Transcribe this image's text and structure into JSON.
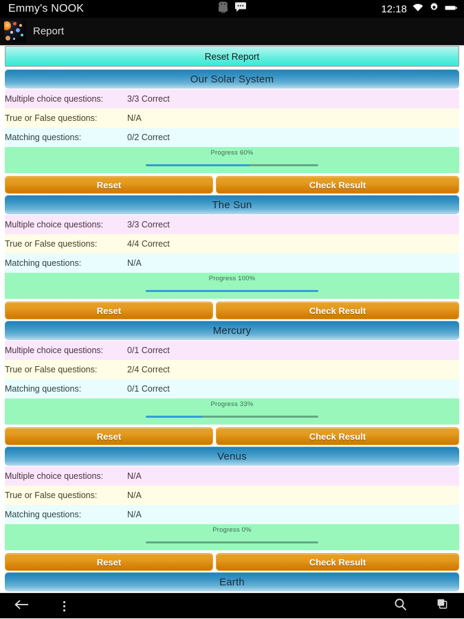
{
  "status_bar": {
    "title": "Emmy's NOOK",
    "clock": "12:18",
    "icons": [
      "android-robot-icon",
      "chat-bubble-icon",
      "wifi-icon",
      "gear-icon",
      "battery-icon"
    ]
  },
  "action_bar": {
    "app_icon": "solar-system-app-icon",
    "title": "Report"
  },
  "toolbar": {
    "reset_report_label": "Reset Report"
  },
  "labels": {
    "multiple_choice": "Multiple choice questions:",
    "true_false": "True or False questions:",
    "matching": "Matching questions:",
    "reset": "Reset",
    "check_result": "Check Result"
  },
  "colors": {
    "header_blue": "#3b96c6",
    "button_orange": "#d88409",
    "reset_report_cyan": "#39e9d4",
    "progress_bg": "#99f7bc",
    "progress_fill": "#3aa8dd",
    "progress_track": "#64a884",
    "row_mc": "#fbe7fb",
    "row_tf": "#fffde6",
    "row_mt": "#e9fdff"
  },
  "sections": [
    {
      "title": "Our Solar System",
      "multiple_choice": "3/3 Correct",
      "true_false": "N/A",
      "matching": "0/2 Correct",
      "progress_label": "Progress 60%",
      "progress_percent": 60
    },
    {
      "title": "The Sun",
      "multiple_choice": "3/3 Correct",
      "true_false": "4/4 Correct",
      "matching": "N/A",
      "progress_label": "Progress 100%",
      "progress_percent": 100
    },
    {
      "title": "Mercury",
      "multiple_choice": "0/1 Correct",
      "true_false": "2/4 Correct",
      "matching": "0/1 Correct",
      "progress_label": "Progress 33%",
      "progress_percent": 33
    },
    {
      "title": "Venus",
      "multiple_choice": "N/A",
      "true_false": "N/A",
      "matching": "N/A",
      "progress_label": "Progress 0%",
      "progress_percent": 0
    },
    {
      "title": "Earth",
      "multiple_choice": "",
      "true_false": "",
      "matching": "",
      "progress_label": "",
      "progress_percent": 0,
      "clipped": true
    }
  ],
  "nav_bar": {
    "back": "back-arrow-icon",
    "menu": "overflow-menu-icon",
    "search": "search-icon",
    "recents": "recent-apps-icon"
  }
}
